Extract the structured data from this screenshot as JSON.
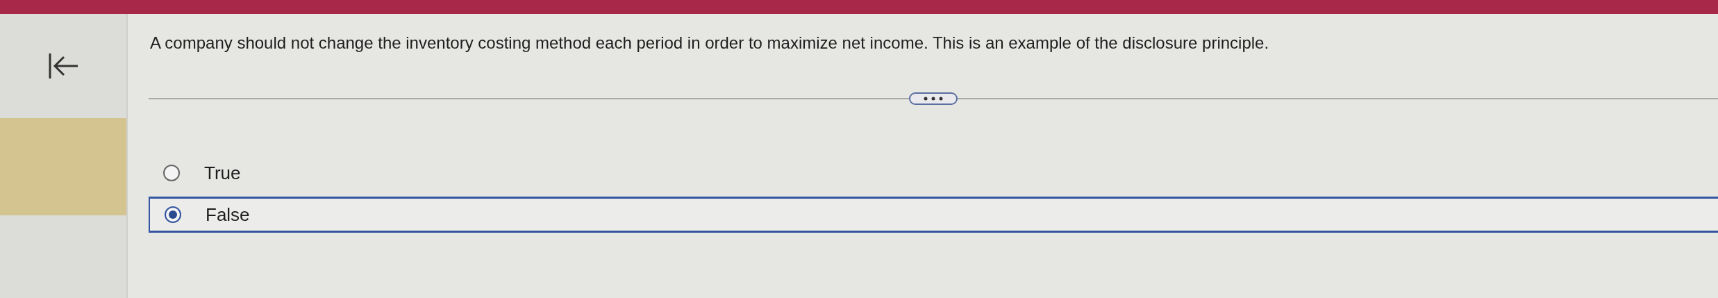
{
  "question": {
    "text": "A company should not change the inventory costing method each period in order to maximize net income. This is an example of the disclosure principle."
  },
  "options": [
    {
      "label": "True",
      "selected": false
    },
    {
      "label": "False",
      "selected": true
    }
  ]
}
